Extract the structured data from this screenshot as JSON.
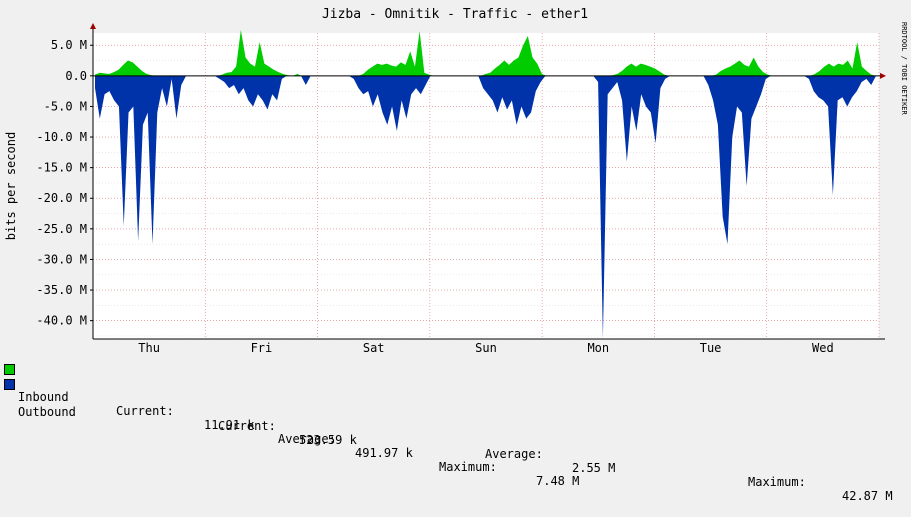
{
  "chart_data": {
    "type": "area",
    "title": "Jizba - Omnitik - Traffic - ether1",
    "ylabel": "bits per second",
    "xlabel": "",
    "watermark": "RRDTOOL / TOBI OETIKER",
    "ylim": [
      -43000000,
      7000000
    ],
    "y_ticks": [
      5000000,
      0,
      -5000000,
      -10000000,
      -15000000,
      -20000000,
      -25000000,
      -30000000,
      -35000000,
      -40000000
    ],
    "y_tick_labels": [
      "5.0 M",
      "0.0",
      "-5.0 M",
      "-10.0 M",
      "-15.0 M",
      "-20.0 M",
      "-25.0 M",
      "-30.0 M",
      "-35.0 M",
      "-40.0 M"
    ],
    "x_labels": [
      "Thu",
      "Fri",
      "Sat",
      "Sun",
      "Mon",
      "Tue",
      "Wed"
    ],
    "grid": true,
    "series": [
      {
        "name": "Inbound",
        "color": "#00cc00",
        "unit": "bits per second",
        "values": [
          0.2,
          0.5,
          0.4,
          0.3,
          0.6,
          1.0,
          1.8,
          2.5,
          2.2,
          1.5,
          0.8,
          0.3,
          0.1,
          0,
          0,
          0,
          0,
          0,
          0,
          0,
          0,
          0,
          0,
          0,
          0,
          0,
          0,
          0.2,
          0.5,
          0.6,
          1.5,
          7.5,
          3.0,
          2.0,
          1.5,
          5.5,
          2.0,
          1.5,
          1.0,
          0.6,
          0.3,
          0.1,
          0,
          0.3,
          0,
          0,
          0,
          0,
          0,
          0,
          0,
          0,
          0,
          0,
          0,
          0,
          0,
          0.3,
          1.0,
          1.5,
          2.0,
          1.8,
          2.0,
          1.7,
          1.5,
          2.2,
          1.8,
          4.0,
          1.5,
          7.3,
          0.5,
          0.2,
          0,
          0,
          0,
          0,
          0,
          0,
          0,
          0,
          0,
          0,
          0,
          0.3,
          0.5,
          1.2,
          1.8,
          2.5,
          1.8,
          2.5,
          3.0,
          5.0,
          6.5,
          3.0,
          2.0,
          0.3,
          0,
          0,
          0,
          0,
          0,
          0,
          0,
          0,
          0,
          0,
          0,
          0,
          0,
          0,
          0.1,
          0.3,
          0.8,
          1.5,
          2.0,
          1.5,
          2.0,
          1.8,
          1.5,
          1.2,
          0.7,
          0.2,
          0,
          0,
          0,
          0,
          0,
          0,
          0,
          0,
          0,
          0,
          0.2,
          0.8,
          1.2,
          1.5,
          2.0,
          2.5,
          1.8,
          1.5,
          3.0,
          1.5,
          0.6,
          0.2,
          0,
          0,
          0,
          0,
          0,
          0,
          0,
          0,
          0,
          0.3,
          0.8,
          1.5,
          2.0,
          1.5,
          2.0,
          1.8,
          2.5,
          1.2,
          5.5,
          1.5,
          0.8,
          0.2,
          0
        ],
        "unit_scale": 1000000
      },
      {
        "name": "Outbound",
        "color": "#0033aa",
        "unit": "bits per second",
        "values": [
          -2.0,
          -7.0,
          -3.0,
          -2.5,
          -4.0,
          -5.0,
          -24.5,
          -6.0,
          -5.0,
          -27.0,
          -8.0,
          -6.0,
          -27.5,
          -6.0,
          -2.0,
          -5.0,
          -0.5,
          -7.0,
          -1.5,
          0,
          0,
          0,
          0,
          0,
          0,
          0,
          -0.5,
          -1.0,
          -2.0,
          -1.5,
          -3.0,
          -2.0,
          -4.0,
          -5.0,
          -3.0,
          -4.0,
          -5.5,
          -3.0,
          -4.0,
          -0.5,
          0,
          0,
          0,
          0,
          -1.5,
          0,
          0,
          0,
          0,
          0,
          0,
          0,
          0,
          0,
          -0.5,
          -2.0,
          -3.0,
          -2.5,
          -5.0,
          -3.0,
          -6.0,
          -8.0,
          -5.0,
          -9.0,
          -4.0,
          -7.0,
          -3.0,
          -2.0,
          -3.0,
          -1.5,
          0,
          0,
          0,
          0,
          0,
          0,
          0,
          0,
          0,
          0,
          0,
          -2.0,
          -3.0,
          -4.0,
          -6.0,
          -3.5,
          -5.5,
          -4.0,
          -8.0,
          -5.0,
          -7.0,
          -6.0,
          -2.5,
          -1.0,
          0,
          0,
          0,
          0,
          0,
          0,
          0,
          0,
          0,
          0,
          0,
          -1.0,
          -42.9,
          -3.0,
          -2.0,
          -1.0,
          -4.0,
          -14.0,
          -5.0,
          -9.0,
          -3.0,
          -5.0,
          -6.0,
          -11.0,
          -2.0,
          -0.5,
          0,
          0,
          0,
          0,
          0,
          0,
          0,
          0,
          -1.5,
          -4.0,
          -8.0,
          -23.0,
          -27.5,
          -10.0,
          -5.0,
          -6.0,
          -18.0,
          -7.0,
          -5.0,
          -3.0,
          -0.5,
          0,
          0,
          0,
          0,
          0,
          0,
          0,
          0,
          -0.5,
          -2.5,
          -3.5,
          -4.0,
          -5.0,
          -19.5,
          -4.0,
          -3.5,
          -5.0,
          -3.5,
          -2.5,
          -1.0,
          -0.5,
          -1.5,
          0
        ],
        "unit_scale": 1000000
      }
    ],
    "legend": [
      {
        "name": "Inbound",
        "current": "11.91 k",
        "average": "491.97 k",
        "maximum": "7.48 M"
      },
      {
        "name": "Outbound",
        "current": "523.59 k",
        "average": "2.55 M",
        "maximum": "42.87 M"
      }
    ],
    "legend_labels": {
      "current": "Current:",
      "average": "Average:",
      "maximum": "Maximum:"
    }
  }
}
